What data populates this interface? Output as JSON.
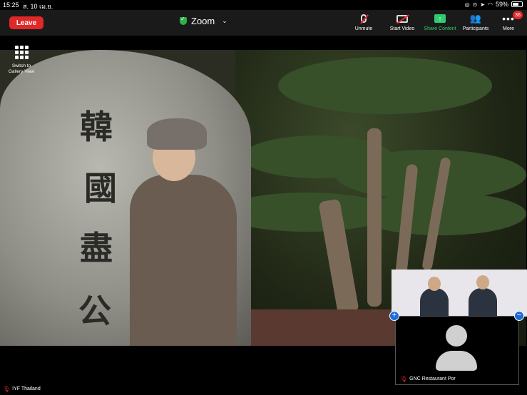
{
  "status_bar": {
    "time": "15:25",
    "date": "ส. 10 เม.ย.",
    "battery": "59%"
  },
  "top_bar": {
    "leave_label": "Leave",
    "title": "Zoom",
    "tools": {
      "unmute": "Unmute",
      "start_video": "Start Video",
      "share_content": "Share Content",
      "participants": "Participants",
      "more": "More",
      "more_badge": "36"
    }
  },
  "gallery_switch": {
    "label_line1": "Switch to",
    "label_line2": "Gallery View"
  },
  "main_video": {
    "calligraphy": [
      "韓",
      "國",
      "盡",
      "公"
    ]
  },
  "self_tile": {
    "name": "GNC Restaurant Por"
  },
  "active_speaker": {
    "name": "IYF Thailand"
  },
  "colors": {
    "leave": "#e02828",
    "share": "#2ecc71",
    "encryption_shield": "#2ab34a",
    "tile_controls": "#1e6bd6"
  }
}
